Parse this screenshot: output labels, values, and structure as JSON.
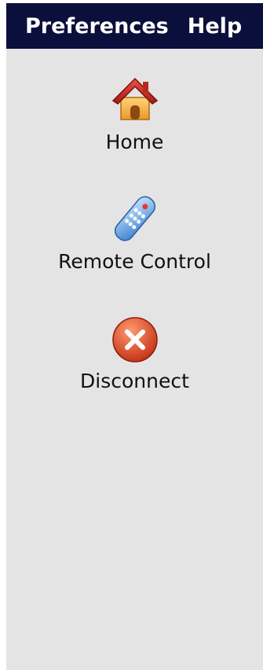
{
  "menubar": {
    "items": [
      {
        "label": "Preferences"
      },
      {
        "label": "Help"
      }
    ],
    "background": "#0a0f3c"
  },
  "sidebar": {
    "background": "#e4e4e4",
    "items": [
      {
        "label": "Home",
        "icon": "house-icon"
      },
      {
        "label": "Remote Control",
        "icon": "remote-control-icon"
      },
      {
        "label": "Disconnect",
        "icon": "disconnect-x-icon"
      }
    ]
  }
}
